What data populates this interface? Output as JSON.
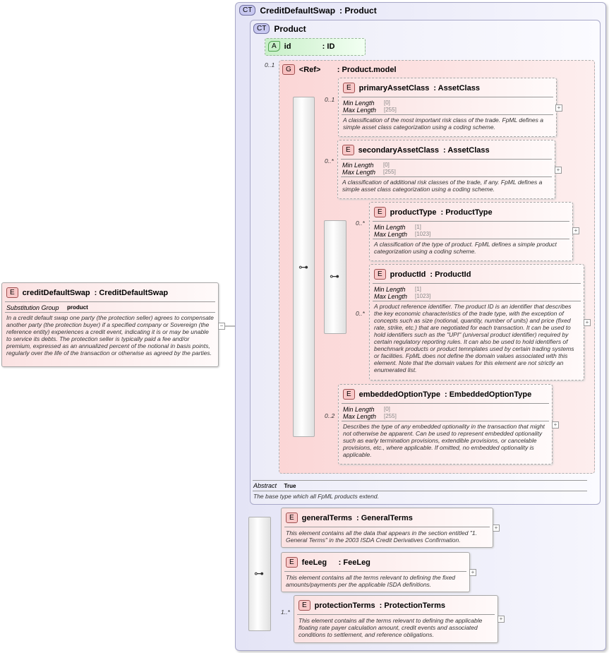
{
  "root": {
    "badge": "CT",
    "title": "CreditDefaultSwap",
    "type": ": Product"
  },
  "product": {
    "badge": "CT",
    "title": "Product",
    "abstract_label": "Abstract",
    "abstract_value": "True",
    "description": "The base type which all FpML products extend."
  },
  "attribute": {
    "badge": "A",
    "name": "id",
    "type": ": ID",
    "cardinality": "0..1"
  },
  "group": {
    "badge": "G",
    "name": "<Ref>",
    "type": ": Product.model"
  },
  "facet_labels": {
    "min": "Min Length",
    "max": "Max Length"
  },
  "elements": {
    "primaryAssetClass": {
      "badge": "E",
      "name": "primaryAssetClass",
      "type": ": AssetClass",
      "cardinality": "0..1",
      "min": "[0]",
      "max": "[255]",
      "description": "A classification of the most important risk class of the trade. FpML defines a simple asset class categorization using a coding scheme."
    },
    "secondaryAssetClass": {
      "badge": "E",
      "name": "secondaryAssetClass",
      "type": ": AssetClass",
      "cardinality": "0..*",
      "min": "[0]",
      "max": "[255]",
      "description": "A classification of additional risk classes of the trade, if any. FpML defines a simple asset class categorization using a coding scheme."
    },
    "productType": {
      "badge": "E",
      "name": "productType",
      "type": ": ProductType",
      "cardinality": "0..*",
      "min": "[1]",
      "max": "[1023]",
      "description": "A classification of the type of product. FpML defines a simple product categorization using a coding scheme."
    },
    "productId": {
      "badge": "E",
      "name": "productId",
      "type": ": ProductId",
      "cardinality": "0..*",
      "min": "[1]",
      "max": "[1023]",
      "description": "A product reference identifier. The product ID is an identifier that describes the key economic characteristics of the trade type, with the exception of concepts such as size (notional, quantity, number of units) and price (fixed rate, strike, etc.) that are negotiated for each transaction. It can be used to hold identifiers such as the \"UPI\" (universal product identifier) required by certain regulatory reporting rules. It can also be used to hold identifiers of benchmark products or product temnplates used by certain trading systems or facilities. FpML does not define the domain values associated with this element. Note that the domain values for this element are not strictly an enumerated list."
    },
    "embeddedOptionType": {
      "badge": "E",
      "name": "embeddedOptionType",
      "type": ": EmbeddedOptionType",
      "cardinality": "0..2",
      "min": "[0]",
      "max": "[255]",
      "description": "Describes the type of any embedded optionality in the transaction that might not otherwise be apparent. Can be used to represent embedded optionality such as early termination provisions, extendible provisions, or cancelable provisions, etc., where applicable. If omitted, no embedded optionality is applicable."
    },
    "generalTerms": {
      "badge": "E",
      "name": "generalTerms",
      "type": ": GeneralTerms",
      "description": "This element contains all the data that appears in the section entitled \"1. General Terms\" in the 2003 ISDA Credit Derivatives Confirmation."
    },
    "feeLeg": {
      "badge": "E",
      "name": "feeLeg",
      "type": ": FeeLeg",
      "description": "This element contains all the terms relevant to defining the fixed amounts/payments per the applicable ISDA definitions."
    },
    "protectionTerms": {
      "badge": "E",
      "name": "protectionTerms",
      "type": ": ProtectionTerms",
      "cardinality": "1..*",
      "description": "This element contains all the terms relevant to defining the applicable floating rate payer calculation amount, credit events and associated conditions to settlement, and reference obligations."
    }
  },
  "left_element": {
    "badge": "E",
    "name": "creditDefaultSwap",
    "type": ": CreditDefaultSwap",
    "subst_label": "Substitution Group",
    "subst_value": "product",
    "description": "In a credit default swap one party (the protection seller) agrees to compensate another party (the protection buyer) if a specified company or Sovereign (the reference entity) experiences a credit event, indicating it is or may be unable to service its debts. The protection seller is typically paid a fee and/or premium, expressed as an annualized percent of the notional in basis points, regularly over the life of the transaction or otherwise as agreed by the parties."
  },
  "icons": {
    "plus": "+",
    "minus": "−",
    "sequence": "sequence-icon"
  }
}
